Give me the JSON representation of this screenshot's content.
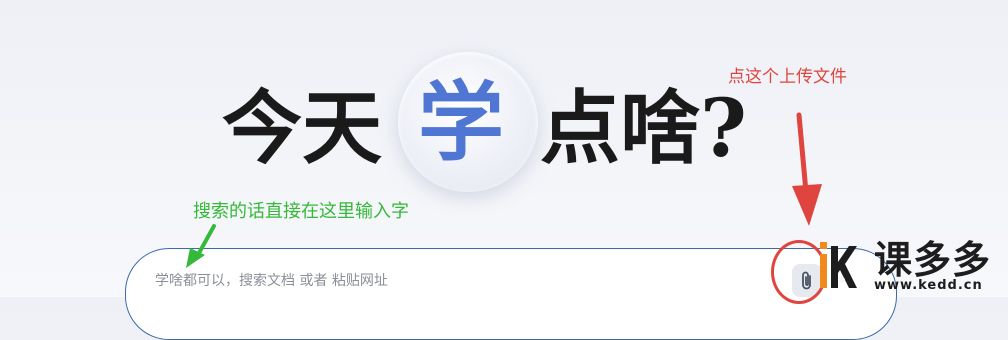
{
  "hero": {
    "title_part1": "今天",
    "title_highlight": "学",
    "title_part2": "点啥?"
  },
  "search": {
    "placeholder": "学啥都可以，搜索文档 或者 粘贴网址",
    "value": ""
  },
  "upload": {
    "icon": "paperclip-icon"
  },
  "annotations": {
    "upload_hint": "点这个上传文件",
    "search_hint": "搜索的话直接在这里输入字"
  },
  "watermark": {
    "brand": "课多多",
    "url": "www.kedd.cn"
  },
  "colors": {
    "highlight": "#4f76d2",
    "annotation_red": "#e0443e",
    "annotation_green": "#35b93a",
    "search_border": "#3a6aa8"
  }
}
